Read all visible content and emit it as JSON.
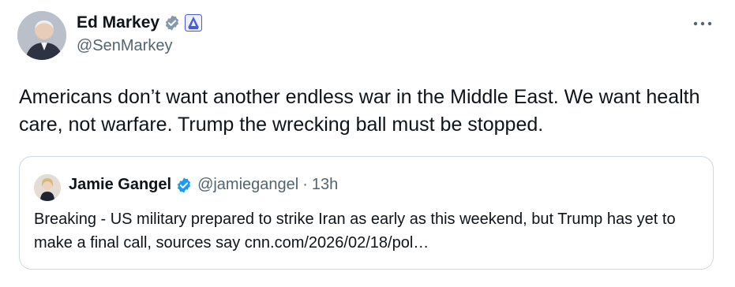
{
  "tweet": {
    "author": {
      "display_name": "Ed Markey",
      "handle": "@SenMarkey",
      "verified_icon": "verified-gray-badge-icon",
      "affiliation_icon": "senate-affiliation-icon"
    },
    "more_icon": "more-icon",
    "text": "Americans don’t want another endless war in the Middle East. We want health care, not warfare. Trump the wrecking ball must be stopped."
  },
  "quote": {
    "author": {
      "display_name": "Jamie Gangel",
      "handle": "@jamiegangel",
      "separator": "·",
      "time": "13h",
      "verified_icon": "verified-blue-badge-icon"
    },
    "text": "Breaking - US military prepared to strike Iran as early as this weekend, but Trump has yet to make a final call, sources say cnn.com/2026/02/18/pol…"
  },
  "colors": {
    "text_primary": "#0f1419",
    "text_secondary": "#536471",
    "verified_gray": "#829aab",
    "verified_blue": "#1d9bf0",
    "senate_icon": "#4a5bd4",
    "border": "#cfd9de"
  }
}
